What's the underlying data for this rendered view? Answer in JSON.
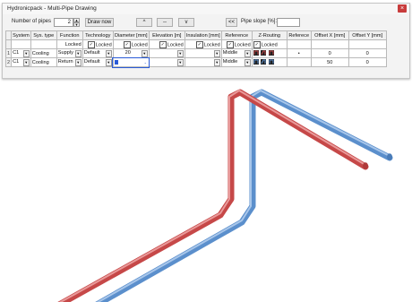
{
  "window": {
    "title": "Hydronicpack - Multi-Pipe Drawing"
  },
  "toolbar": {
    "pipes_label": "Number of pipes",
    "pipes_value": "2",
    "draw_label": "Draw now",
    "up_symbol": "^",
    "middle_symbol": "--",
    "down_symbol": "v",
    "collapse_symbol": "<<",
    "slope_label": "Pipe slope [%]:",
    "slope_value": ""
  },
  "table": {
    "headers": [
      "System",
      "Sys. type",
      "Function",
      "Technology",
      "Diameter [mm]",
      "Elevation [m]",
      "Insulation [mm]",
      "Reference",
      "Z-Routing",
      "Referece",
      "Offset X [mm]",
      "Offset Y [mm]"
    ],
    "locked_label": "Locked",
    "rows": [
      {
        "num": "1",
        "system": "C1",
        "sys_type": "Cooling",
        "function": "Supply",
        "technology": "Default",
        "diameter": "20",
        "elevation": "",
        "insulation": "",
        "reference": "Middle",
        "referece": "•",
        "offset_x": "0",
        "offset_y": "0"
      },
      {
        "num": "2",
        "system": "C1",
        "sys_type": "Cooling",
        "function": "Return",
        "technology": "Default",
        "diameter": "",
        "elevation": "",
        "insulation": "",
        "reference": "Middle",
        "referece": "",
        "offset_x": "50",
        "offset_y": "0"
      }
    ]
  },
  "colors": {
    "supply_pipe": "#c64848",
    "return_pipe": "#5b8fcc",
    "close_button": "#c83c3c"
  },
  "icons": [
    "spin-up-icon",
    "spin-down-icon",
    "dropdown-arrow-icon",
    "checkbox-checked-icon",
    "close-icon",
    "z-routing-icon",
    "bullet-icon"
  ]
}
